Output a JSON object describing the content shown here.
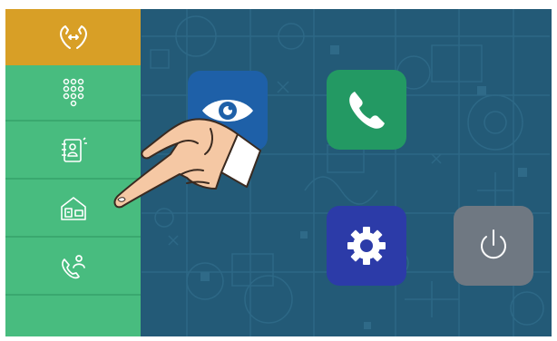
{
  "sidebar": {
    "items": [
      {
        "icon": "door-intercom-icon",
        "active": true
      },
      {
        "icon": "keypad-icon",
        "active": false
      },
      {
        "icon": "address-book-icon",
        "active": false
      },
      {
        "icon": "home-monitor-icon",
        "active": false
      },
      {
        "icon": "call-contact-icon",
        "active": false
      }
    ]
  },
  "tiles": [
    {
      "icon": "eye-icon",
      "color": "#1e60a8"
    },
    {
      "icon": "phone-icon",
      "color": "#239963"
    },
    {
      "icon": "gear-icon",
      "color": "#2c3ba8"
    },
    {
      "icon": "power-icon",
      "color": "#6f7882"
    }
  ],
  "colors": {
    "background": "#235a77",
    "sidebar": "#48bc7f",
    "sidebar_active": "#d89f26"
  }
}
